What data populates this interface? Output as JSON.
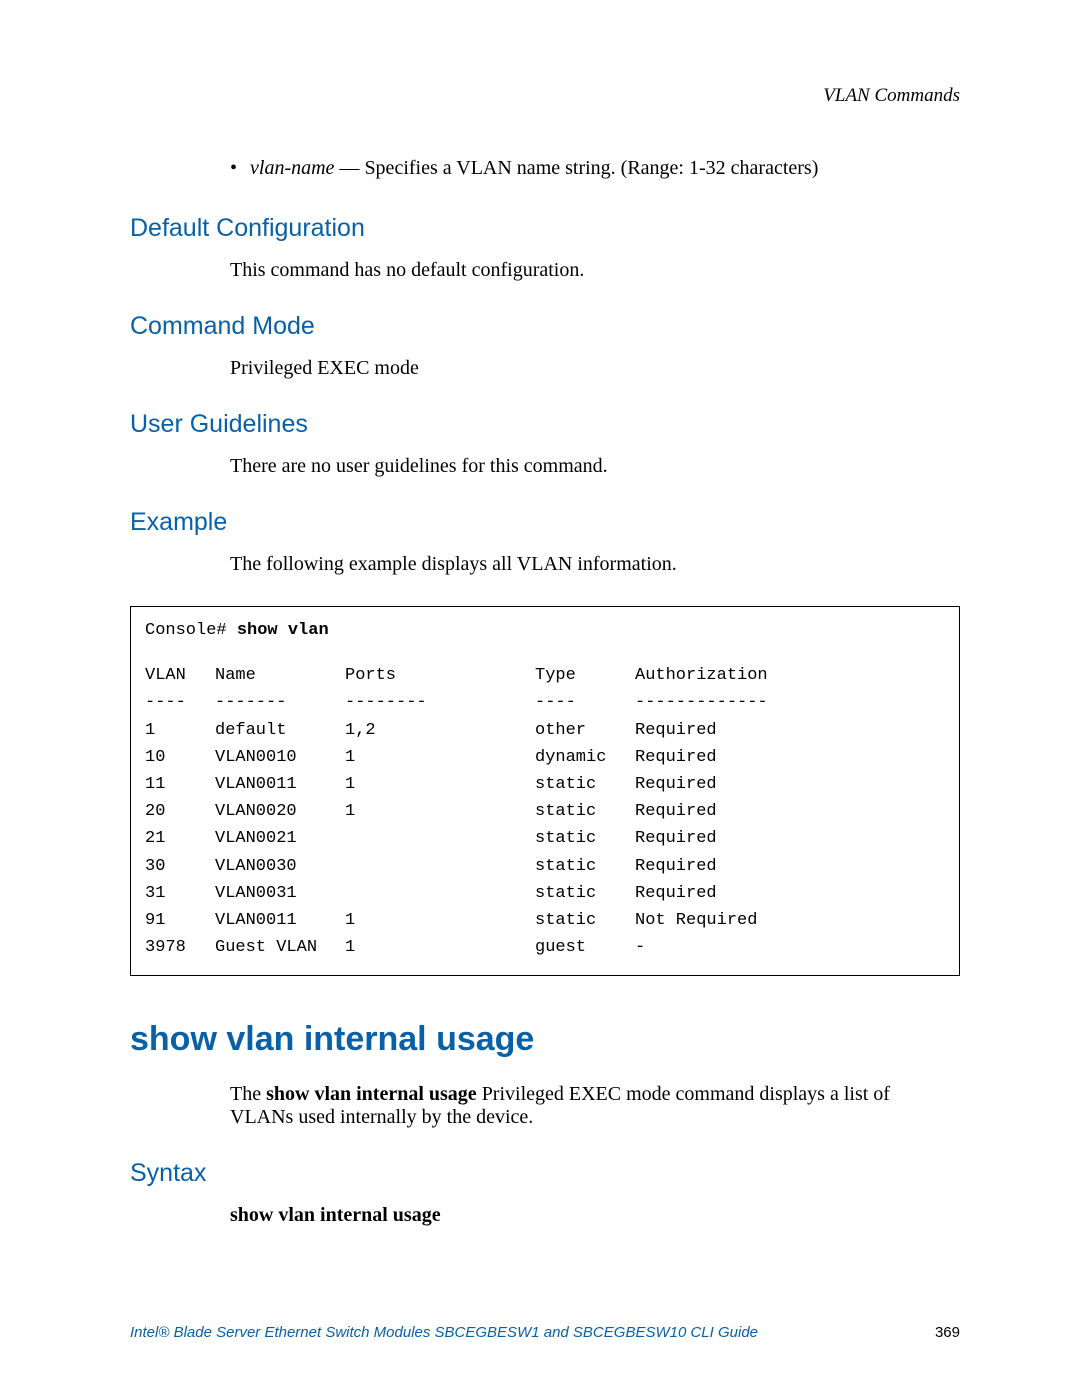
{
  "header": {
    "section": "VLAN Commands"
  },
  "bullet": {
    "term": "vlan-name",
    "desc": " — Specifies a VLAN name string. (Range: 1-32 characters)"
  },
  "sections": {
    "default_cfg": {
      "title": "Default Configuration",
      "text": "This command has no default configuration."
    },
    "cmd_mode": {
      "title": "Command Mode",
      "text": "Privileged EXEC mode"
    },
    "user_guide": {
      "title": "User Guidelines",
      "text": "There are no user guidelines for this command."
    },
    "example": {
      "title": "Example",
      "text": "The following example displays all VLAN information."
    },
    "syntax": {
      "title": "Syntax",
      "cmd": "show vlan internal usage"
    }
  },
  "code": {
    "prompt": "Console# ",
    "command": "show vlan",
    "headers": {
      "vlan": "VLAN",
      "name": "Name",
      "ports": "Ports",
      "type": "Type",
      "auth": "Authorization"
    },
    "divider": {
      "vlan": "----",
      "name": "-------",
      "ports": "--------",
      "type": "----",
      "auth": "-------------"
    },
    "rows": [
      {
        "vlan": "1",
        "name": "default",
        "ports": "1,2",
        "type": "other",
        "auth": "Required"
      },
      {
        "vlan": "10",
        "name": "VLAN0010",
        "ports": "1",
        "type": "dynamic",
        "auth": "Required"
      },
      {
        "vlan": "11",
        "name": "VLAN0011",
        "ports": "1",
        "type": "static",
        "auth": "Required"
      },
      {
        "vlan": "20",
        "name": "VLAN0020",
        "ports": "1",
        "type": "static",
        "auth": "Required"
      },
      {
        "vlan": "21",
        "name": "VLAN0021",
        "ports": "",
        "type": "static",
        "auth": "Required"
      },
      {
        "vlan": "30",
        "name": "VLAN0030",
        "ports": "",
        "type": "static",
        "auth": "Required"
      },
      {
        "vlan": "31",
        "name": "VLAN0031",
        "ports": "",
        "type": "static",
        "auth": "Required"
      },
      {
        "vlan": "91",
        "name": "VLAN0011",
        "ports": "1",
        "type": "static",
        "auth": "Not Required"
      },
      {
        "vlan": "3978",
        "name": "Guest VLAN",
        "ports": "1",
        "type": "guest",
        "auth": "-"
      }
    ]
  },
  "cmd2": {
    "title": "show vlan internal usage",
    "desc_pre": "The ",
    "desc_bold": "show vlan internal usage",
    "desc_post": " Privileged EXEC mode command displays a list of VLANs used internally by the device."
  },
  "footer": {
    "text": "Intel® Blade Server Ethernet Switch Modules SBCEGBESW1 and SBCEGBESW10 CLI Guide",
    "page": "369"
  }
}
